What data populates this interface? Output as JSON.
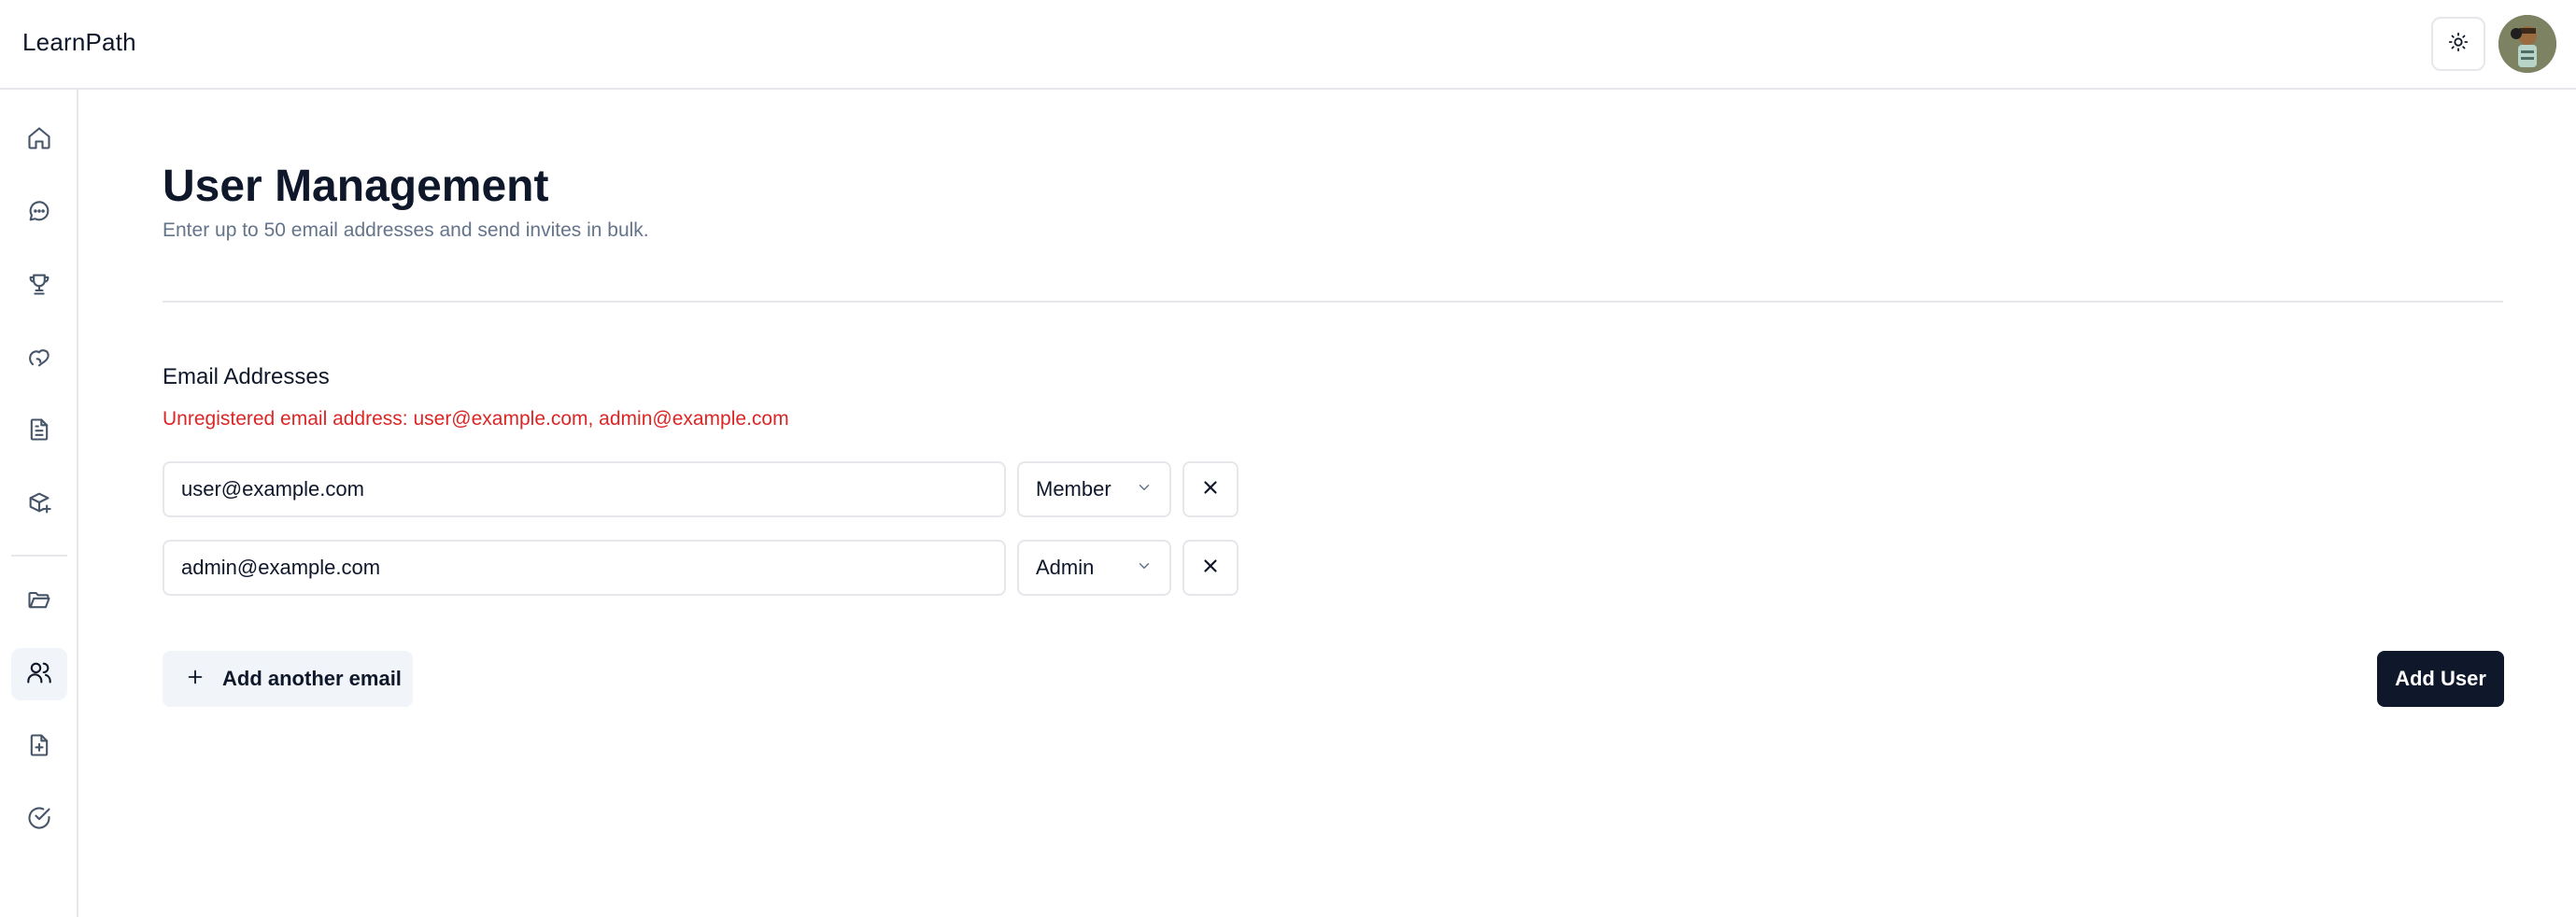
{
  "app": {
    "title": "LearnPath"
  },
  "header": {
    "theme_toggle_icon": "sun-icon",
    "avatar_icon": "user-avatar"
  },
  "sidebar": {
    "items": [
      {
        "icon": "home-icon",
        "active": false
      },
      {
        "icon": "chat-icon",
        "active": false
      },
      {
        "icon": "trophy-icon",
        "active": false
      },
      {
        "icon": "hand-heart-icon",
        "active": false
      },
      {
        "icon": "document-icon",
        "active": false
      },
      {
        "icon": "package-plus-icon",
        "active": false
      },
      {
        "icon": "folder-open-icon",
        "active": false
      },
      {
        "icon": "users-icon",
        "active": true
      },
      {
        "icon": "file-plus-icon",
        "active": false
      },
      {
        "icon": "check-circle-icon",
        "active": false
      }
    ]
  },
  "page": {
    "title": "User Management",
    "subtitle": "Enter up to 50 email addresses and send invites in bulk."
  },
  "form": {
    "section_label": "Email Addresses",
    "error": "Unregistered email address: user@example.com, admin@example.com",
    "rows": [
      {
        "email": "user@example.com",
        "role": "Member"
      },
      {
        "email": "admin@example.com",
        "role": "Admin"
      }
    ],
    "add_another_label": "Add another email",
    "submit_label": "Add User"
  },
  "colors": {
    "primary": "#0f172a",
    "error": "#dc2626",
    "muted_text": "#64748b",
    "border": "#e5e7eb",
    "secondary_bg": "#f1f5f9"
  }
}
